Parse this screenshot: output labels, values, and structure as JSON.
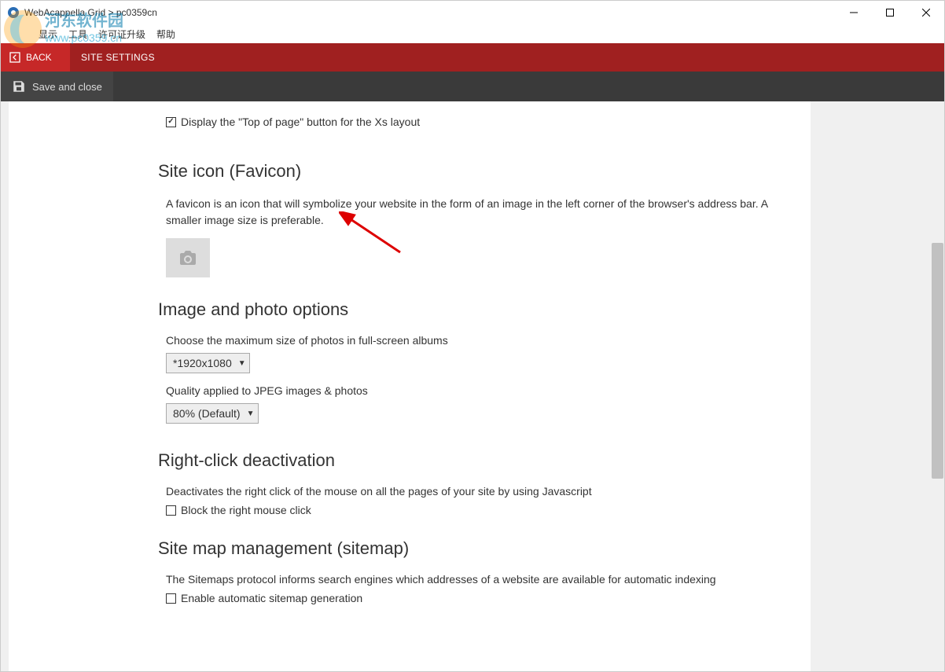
{
  "titlebar": {
    "text": "WebAcappella Grid > pc0359cn"
  },
  "menubar": {
    "items": [
      "显示",
      "工具",
      "许可证升级",
      "帮助"
    ]
  },
  "redbar": {
    "back": "BACK",
    "title": "SITE SETTINGS"
  },
  "toolbar2": {
    "save": "Save and close"
  },
  "topOfPage": {
    "label": "Display the \"Top of page\" button for the Xs layout"
  },
  "favicon": {
    "heading": "Site icon (Favicon)",
    "desc": "A favicon is an icon that will symbolize your website in the form of an image in the left corner of the browser's address bar. A smaller image size is preferable."
  },
  "imageOptions": {
    "heading": "Image and photo options",
    "sizeLabel": "Choose the maximum size of photos in full-screen albums",
    "sizeValue": "*1920x1080",
    "qualityLabel": "Quality applied to JPEG images & photos",
    "qualityValue": "80% (Default)"
  },
  "rightClick": {
    "heading": "Right-click deactivation",
    "desc": "Deactivates the right click of the mouse on all the pages of your site by using Javascript",
    "checkbox": "Block the right mouse click"
  },
  "sitemap": {
    "heading": "Site map management (sitemap)",
    "desc": "The Sitemaps protocol informs search engines which addresses of a website are available for automatic indexing",
    "checkbox": "Enable automatic sitemap generation"
  },
  "watermark": {
    "line1": "河东软件园",
    "line2": "www.pc0359.cn"
  }
}
